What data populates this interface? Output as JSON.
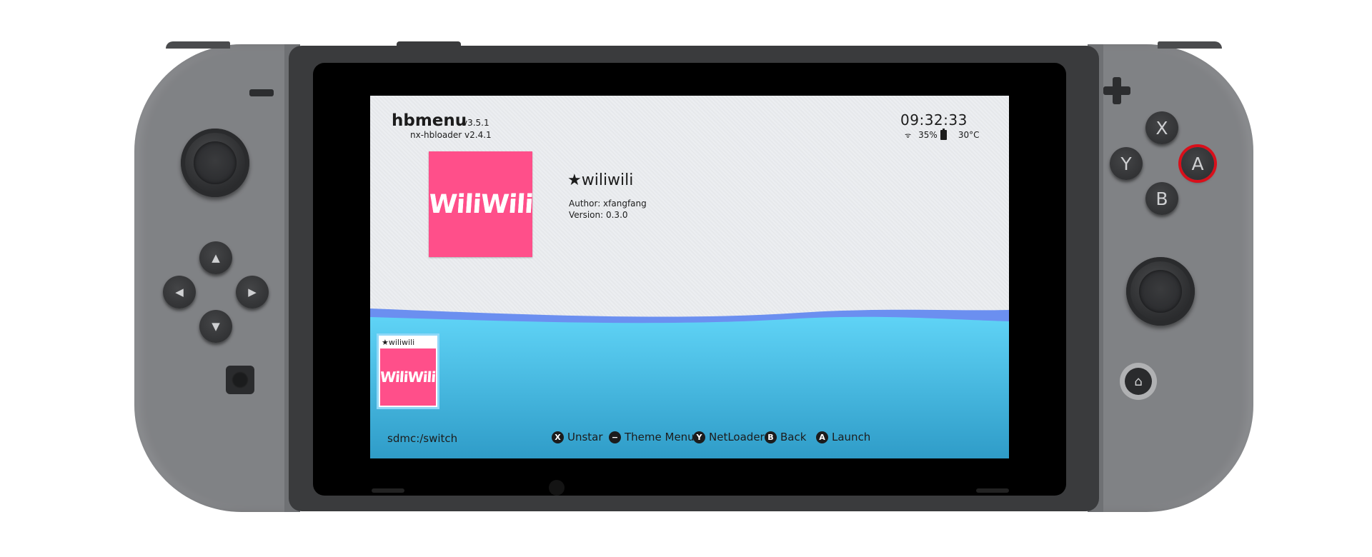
{
  "joycon_left": {
    "minus_icon": "minus-icon",
    "dpad": [
      "up-arrow-icon",
      "left-arrow-icon",
      "right-arrow-icon",
      "down-arrow-icon"
    ],
    "capture_icon": "capture-icon"
  },
  "joycon_right": {
    "plus_icon": "plus-icon",
    "face_buttons": {
      "x": "X",
      "y": "Y",
      "a": "A",
      "b": "B"
    },
    "home_icon": "home-icon",
    "highlight_color": "#d90f1a"
  },
  "screen": {
    "header": {
      "app_name": "hbmenu",
      "app_version": "v3.5.1",
      "loader_version": "nx-hbloader v2.4.1",
      "clock": "09:32:33",
      "battery": "35%",
      "temperature": "30°C"
    },
    "selected_app": {
      "name": "★wiliwili",
      "author": "Author: xfangfang",
      "version": "Version: 0.3.0",
      "logo_text": "WiliWili",
      "icon_color": "#ff4f8a"
    },
    "tiles": [
      {
        "label": "★wiliwili",
        "logo_text": "WiliWili"
      }
    ],
    "footer": {
      "path": "sdmc:/switch",
      "hints": [
        {
          "button": "X",
          "label": "Unstar"
        },
        {
          "button": "−",
          "label": "Theme Menu"
        },
        {
          "button": "Y",
          "label": "NetLoader"
        },
        {
          "button": "B",
          "label": "Back"
        },
        {
          "button": "A",
          "label": "Launch"
        }
      ]
    },
    "colors": {
      "background": "#eceef1",
      "wave_light": "#5fd3f6",
      "wave_dark": "#2f9cc8",
      "wave_accent": "#6b8ff0"
    }
  }
}
